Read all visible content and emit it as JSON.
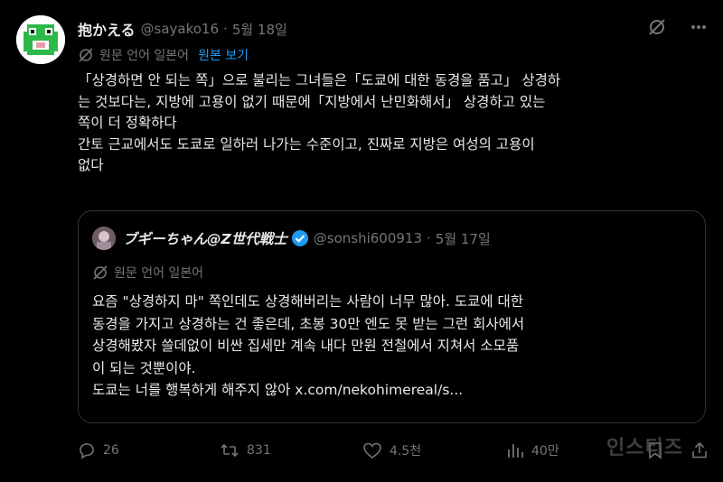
{
  "author": {
    "display_name": "抱かえる",
    "handle": "@sayako16",
    "separator": "·",
    "date": "5월 18일"
  },
  "translation": {
    "source_language": "원문 언어 일본어",
    "show_original": "원본 보기"
  },
  "tweet": {
    "text": "「상경하면 안 되는 쪽」으로 불리는 그녀들은「도쿄에 대한 동경을 품고」 상경하\n는 것보다는, 지방에 고용이 없기 때문에「지방에서 난민화해서」 상경하고 있는\n쪽이 더 정확하다\n간토 근교에서도 도쿄로 일하러 나가는 수준이고, 진짜로 지방은 여성의 고용이\n없다"
  },
  "quoted": {
    "display_name": "ブギーちゃん@Z世代戦士",
    "handle": "@sonshi600913",
    "separator": "·",
    "date": "5월 17일",
    "source_language": "원문 언어 일본어",
    "text": "요즘 \"상경하지 마\" 쪽인데도 상경해버리는 사람이 너무 많아. 도쿄에 대한\n동경을 가지고 상경하는 건 좋은데, 초봉 30만 엔도 못 받는 그런 회사에서\n상경해봤자 쓸데없이 비싼 집세만 계속 내다 만원 전철에서 지쳐서 소모품\n이 되는 것뿐이야.\n도쿄는 너를 행복하게 해주지 않아 x.com/nekohimereal/s..."
  },
  "actions": {
    "replies": "26",
    "retweets": "831",
    "likes": "4.5천",
    "views": "40만"
  },
  "watermark": "인스티즈",
  "icons": [
    "grok-icon",
    "more-icon",
    "translate-icon",
    "verified-icon",
    "reply-icon",
    "retweet-icon",
    "like-icon",
    "views-icon",
    "share-icon"
  ],
  "colors": {
    "background": "#000000",
    "text": "#e7e9ea",
    "muted": "#71767b",
    "link": "#1d9bf0",
    "border": "#2f3336"
  }
}
